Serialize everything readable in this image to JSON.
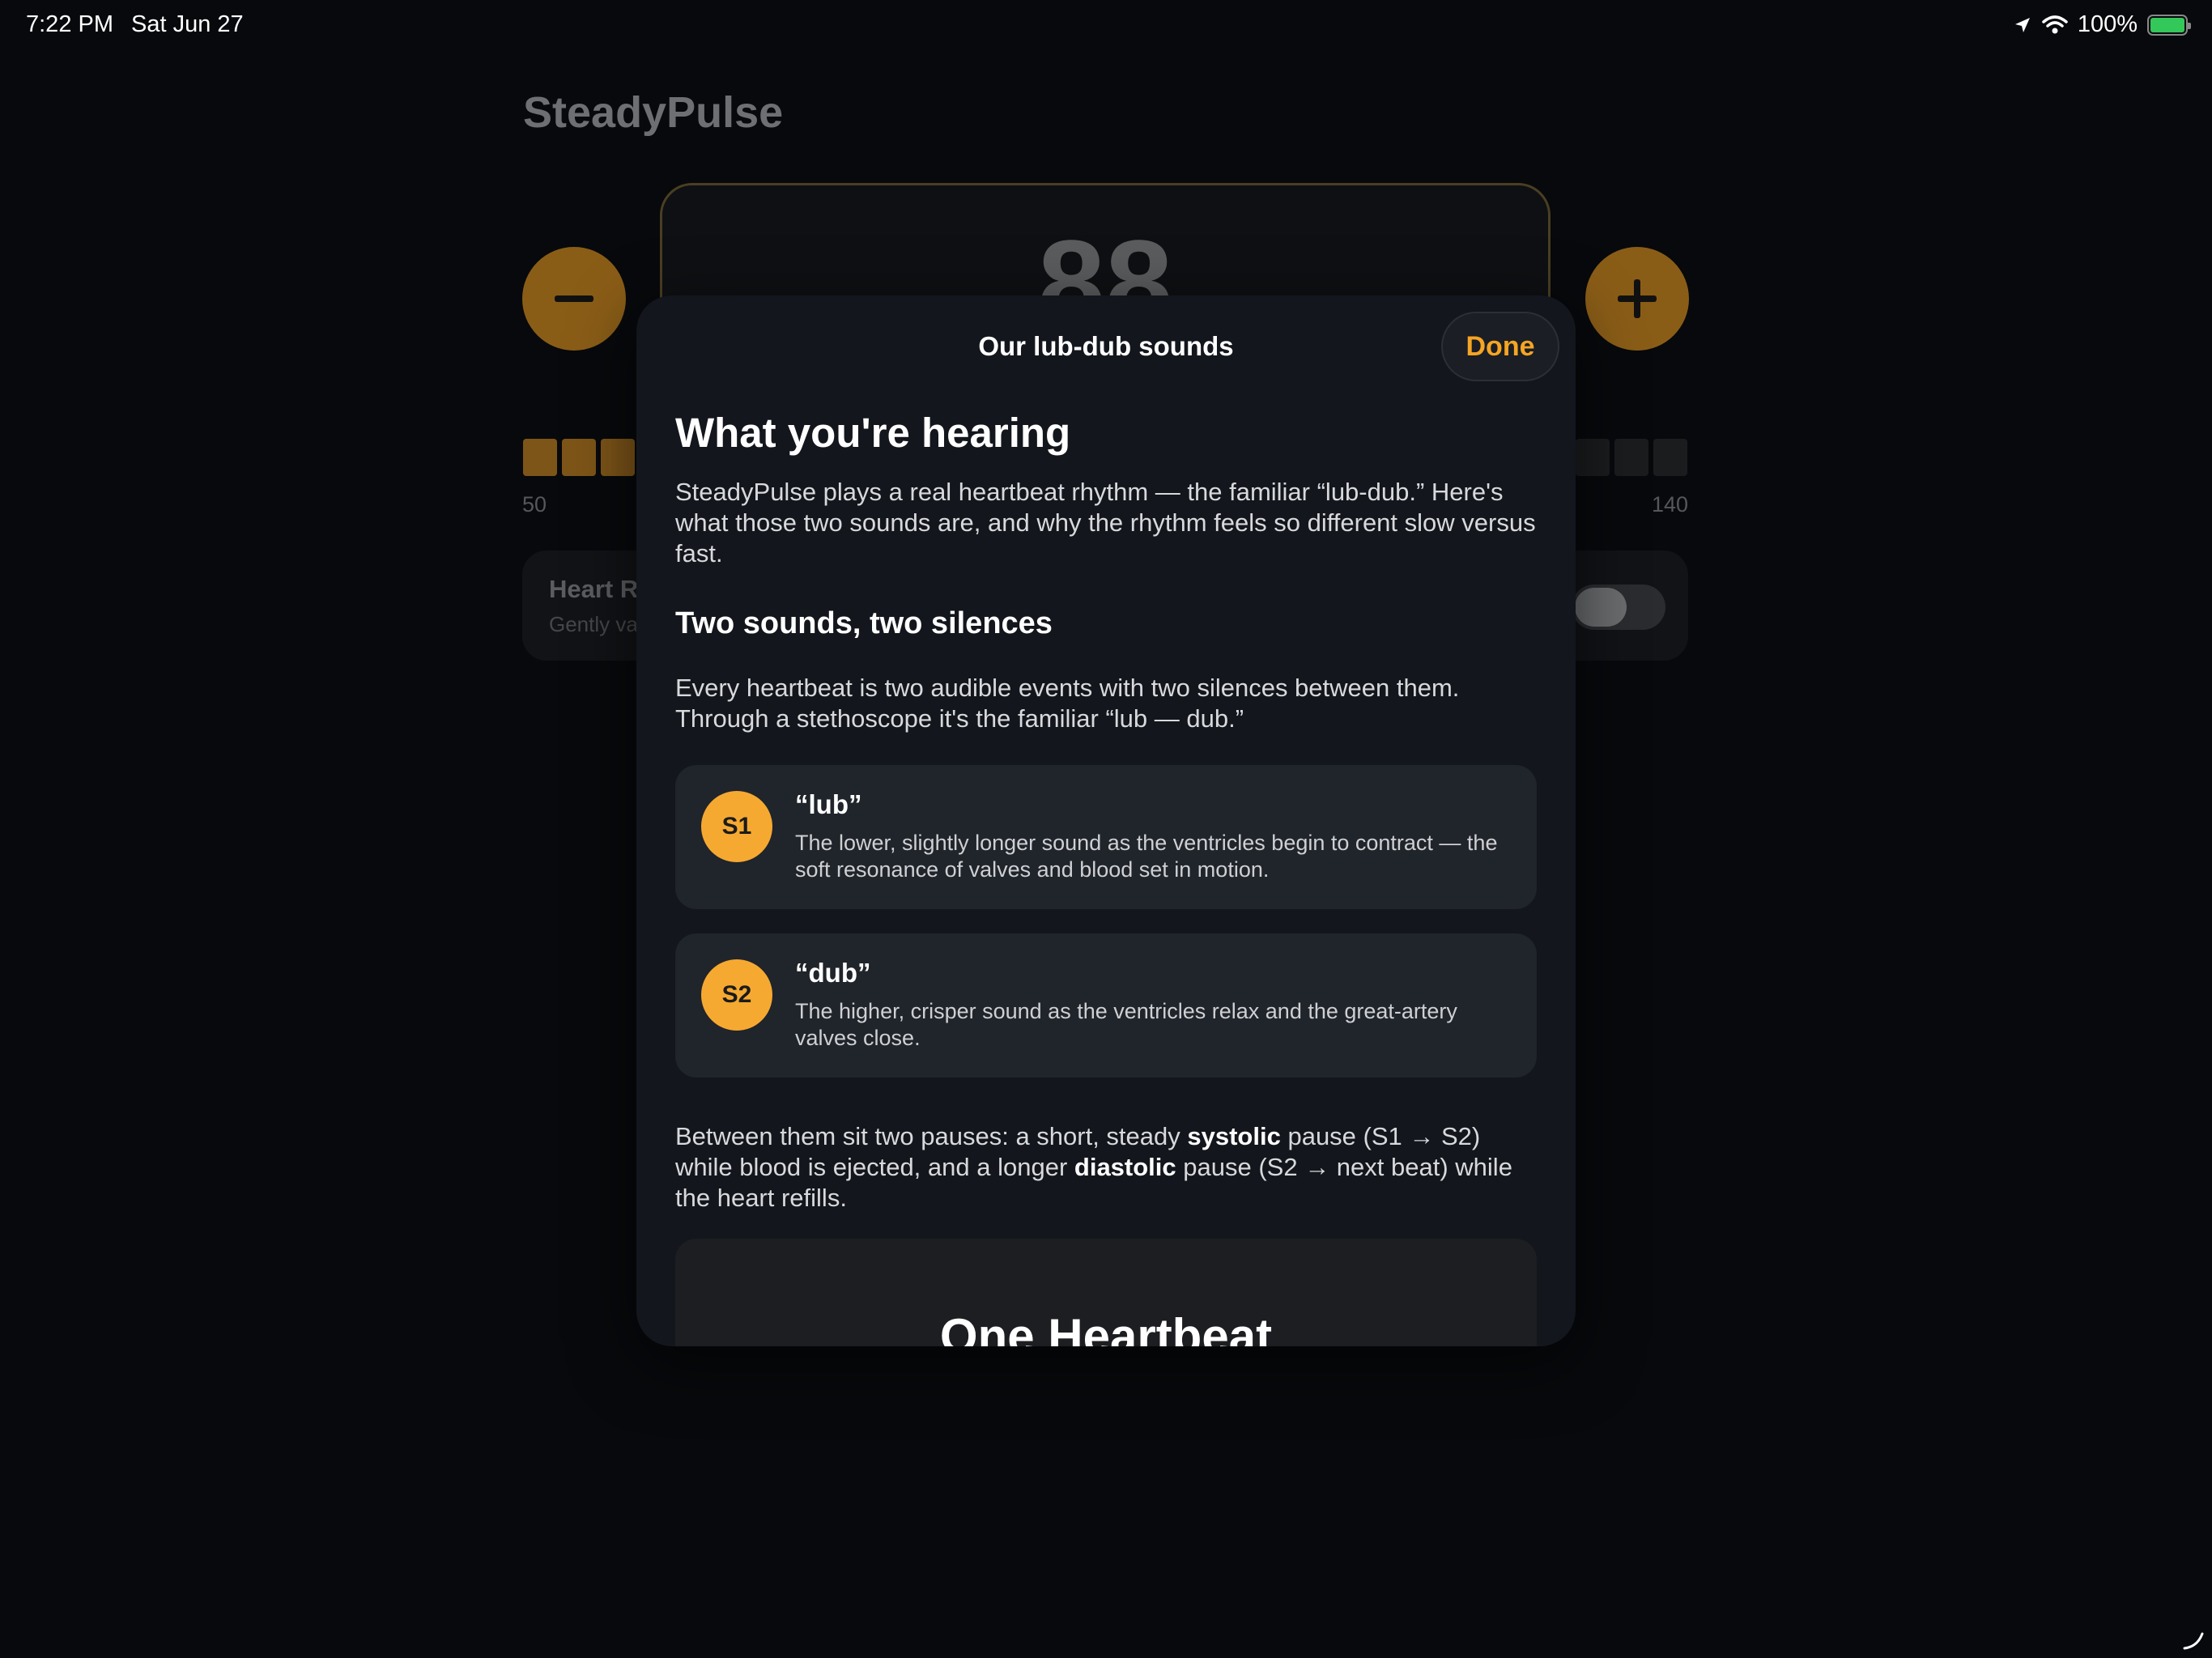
{
  "status_bar": {
    "time": "7:22 PM",
    "date": "Sat Jun 27",
    "battery": "100%",
    "battery_level": 1.0,
    "icons": [
      "location-icon",
      "wifi-icon",
      "battery-charging-icon"
    ]
  },
  "background_app": {
    "title": "SteadyPulse",
    "bpm_value": "88",
    "range_min": "50",
    "range_max": "140",
    "heart_card_title": "Heart R",
    "heart_card_subtitle": "Gently va",
    "accent_color": "#f6a931"
  },
  "sheet": {
    "title": "Our lub-dub sounds",
    "done_label": "Done",
    "heading": "What you're hearing",
    "intro": "SteadyPulse plays a real heartbeat rhythm — the familiar “lub-dub.” Here's what those two sounds are, and why the rhythm feels so different slow versus fast.",
    "section_title": "Two sounds, two silences",
    "section_text": "Every heartbeat is two audible events with two silences between them. Through a stethoscope it's the familiar “lub — dub.”",
    "sounds": [
      {
        "badge": "S1",
        "title": "“lub”",
        "text": "The lower, slightly longer sound as the ventricles begin to contract — the soft resonance of valves and blood set in motion."
      },
      {
        "badge": "S2",
        "title": "“dub”",
        "text": "The higher, crisper sound as the ventricles relax and the great-artery valves close."
      }
    ],
    "pauses": {
      "part1": "Between them sit two pauses: a short, steady ",
      "bold1": "systolic",
      "part2": " pause (S1 → S2) while blood is ejected, and a longer ",
      "bold2": "diastolic",
      "part3": " pause (S2 → next beat) while the heart refills."
    },
    "diagram_title": "One Heartbeat"
  }
}
